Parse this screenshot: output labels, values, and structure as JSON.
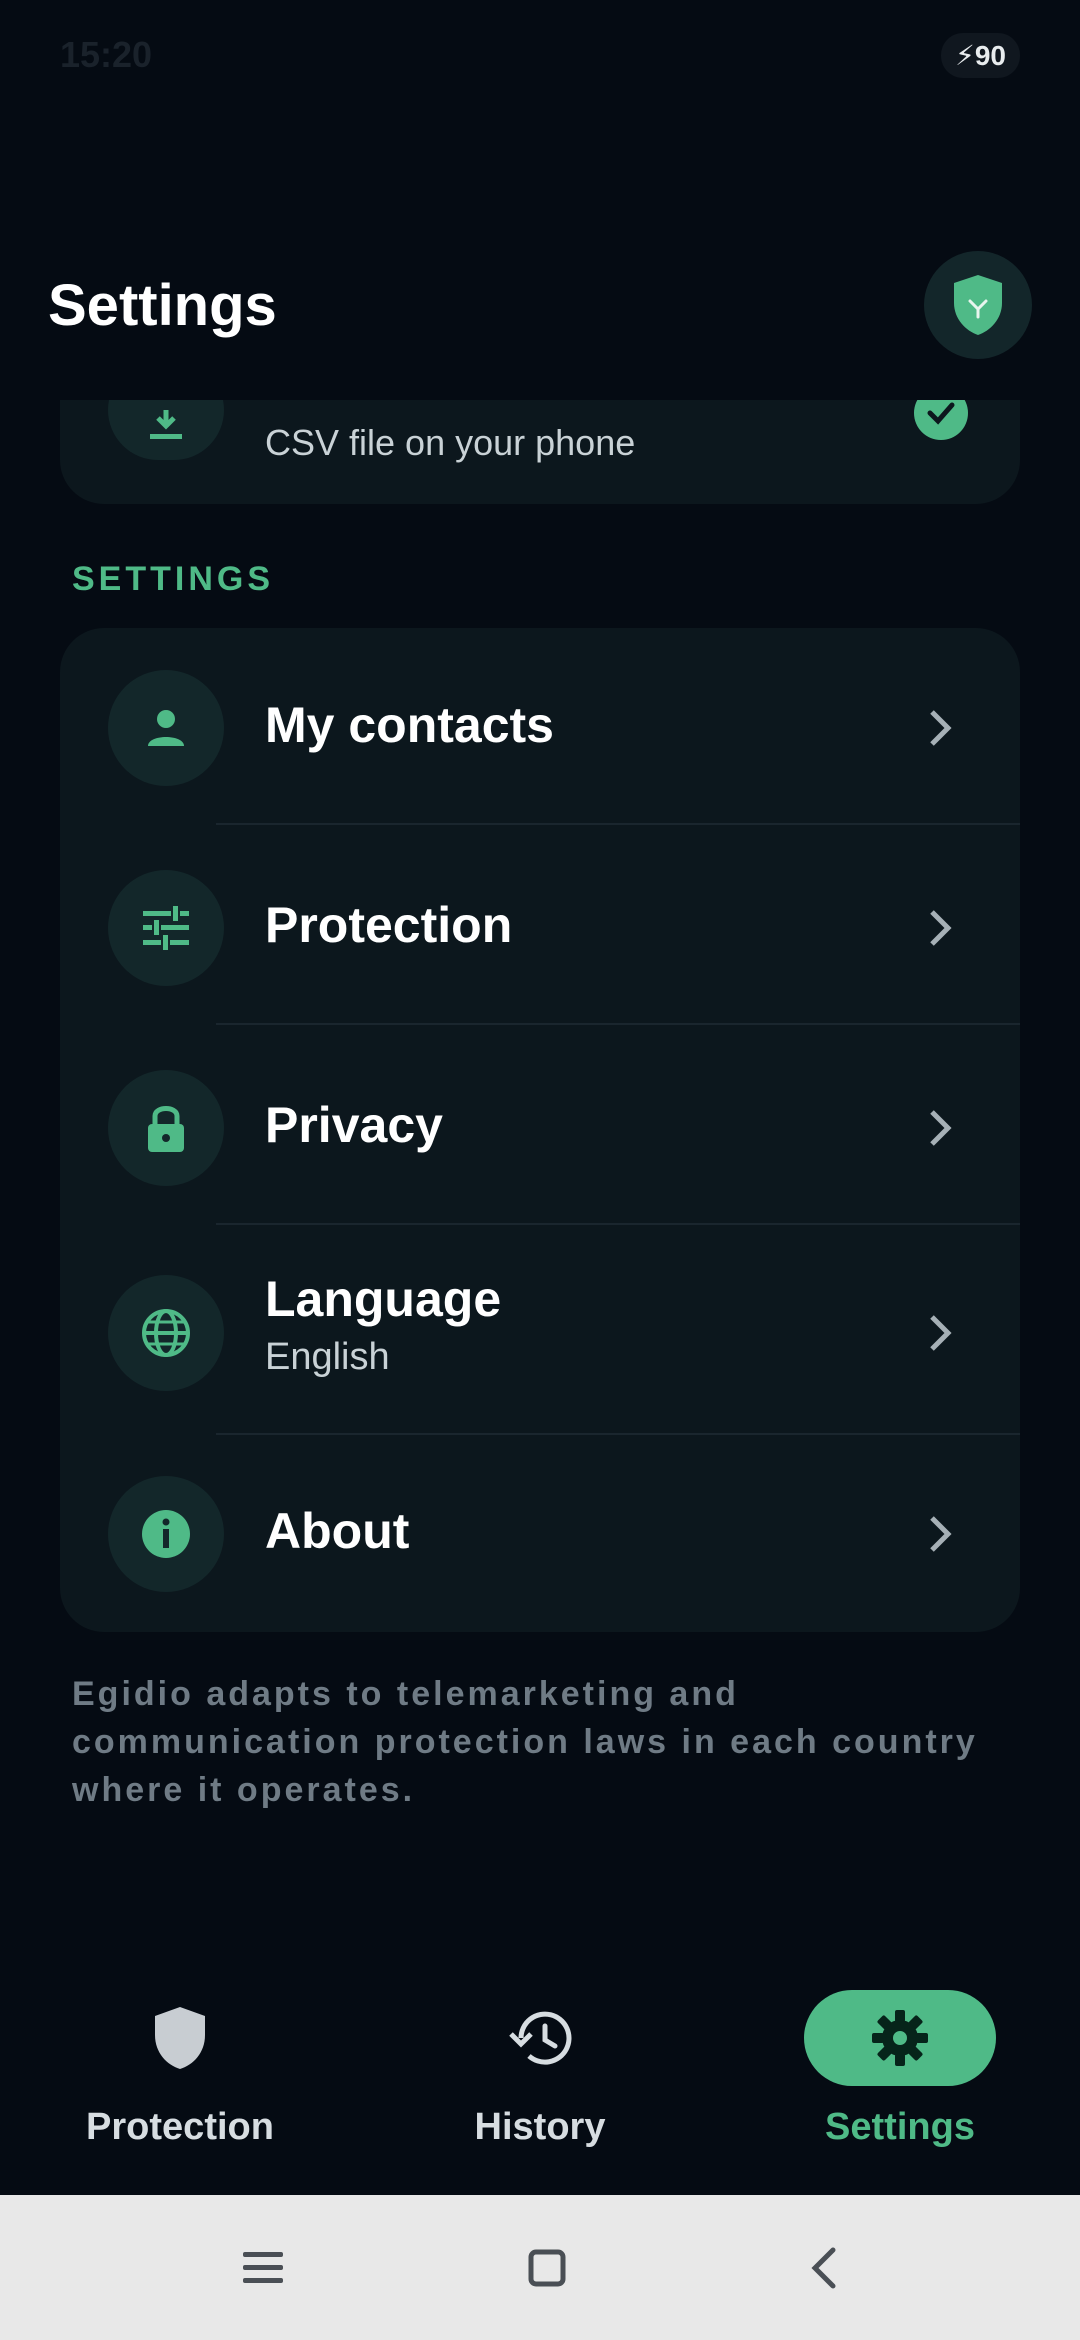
{
  "status_bar": {
    "time": "15:20",
    "battery": "90"
  },
  "header": {
    "title": "Settings"
  },
  "partial_item": {
    "subtitle": "CSV file on your phone"
  },
  "section": {
    "label": "SETTINGS"
  },
  "items": [
    {
      "title": "My contacts",
      "subtitle": "",
      "icon": "person-icon"
    },
    {
      "title": "Protection",
      "subtitle": "",
      "icon": "sliders-icon"
    },
    {
      "title": "Privacy",
      "subtitle": "",
      "icon": "lock-icon"
    },
    {
      "title": "Language",
      "subtitle": "English",
      "icon": "globe-icon"
    },
    {
      "title": "About",
      "subtitle": "",
      "icon": "info-icon"
    }
  ],
  "footnote": "Egidio adapts to telemarketing and communication protection laws in each country where it operates.",
  "nav": [
    {
      "label": "Protection",
      "icon": "shield-icon",
      "active": false
    },
    {
      "label": "History",
      "icon": "history-icon",
      "active": false
    },
    {
      "label": "Settings",
      "icon": "gear-icon",
      "active": true
    }
  ],
  "colors": {
    "accent": "#4fba87",
    "background": "#050b13",
    "card": "#0c171d",
    "icon_bg": "#13272a"
  }
}
